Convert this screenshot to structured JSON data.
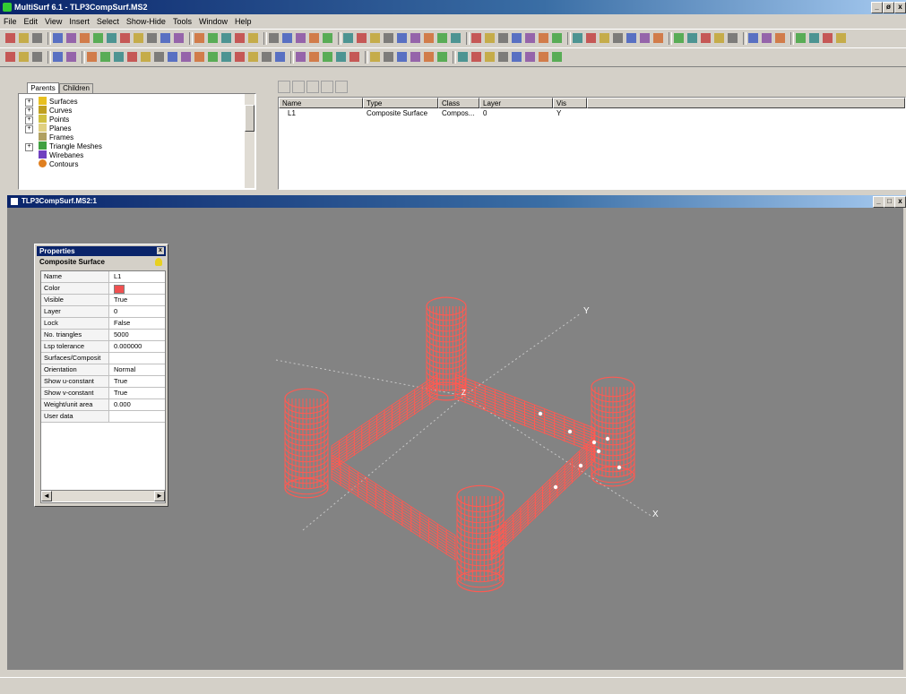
{
  "app": {
    "title": "MultiSurf 6.1 - TLP3CompSurf.MS2",
    "controls": [
      "_",
      "ø",
      "x"
    ]
  },
  "menu": [
    "File",
    "Edit",
    "View",
    "Insert",
    "Select",
    "Show-Hide",
    "Tools",
    "Window",
    "Help"
  ],
  "tree": {
    "tabs": [
      "Parents",
      "Children"
    ],
    "items": [
      "Surfaces",
      "Curves",
      "Points",
      "Planes",
      "Frames",
      "Triangle Meshes",
      "Wirebanes",
      "Contours"
    ]
  },
  "list": {
    "columns": [
      "Name",
      "Type",
      "Class",
      "Layer",
      "Vis"
    ],
    "rows": [
      {
        "name": "L1",
        "type": "Composite Surface",
        "class": "Compos...",
        "layer": "0",
        "vis": "Y"
      }
    ]
  },
  "child_window": {
    "title": "TLP3CompSurf.MS2:1",
    "controls": [
      "_",
      "□",
      "x"
    ]
  },
  "properties": {
    "title": "Properties",
    "entity": "Composite Surface",
    "rows": [
      {
        "key": "Name",
        "value": "L1"
      },
      {
        "key": "Color",
        "value": ""
      },
      {
        "key": "Visible",
        "value": "True"
      },
      {
        "key": "Layer",
        "value": "0"
      },
      {
        "key": "Lock",
        "value": "False"
      },
      {
        "key": "No. triangles",
        "value": "5000"
      },
      {
        "key": "Lsp tolerance",
        "value": "0.000000"
      },
      {
        "key": "Surfaces/Composit",
        "value": ""
      },
      {
        "key": "Orientation",
        "value": "Normal"
      },
      {
        "key": "Show u-constant",
        "value": "True"
      },
      {
        "key": "Show v-constant",
        "value": "True"
      },
      {
        "key": "Weight/unit area",
        "value": "0.000"
      },
      {
        "key": "User data",
        "value": ""
      }
    ],
    "color_swatch": "#f05050"
  },
  "axes": {
    "x": "X",
    "y": "Y",
    "z": "Z"
  },
  "colors": {
    "mesh": "#ff5a52",
    "viewport": "#838383",
    "titlebar": "#0a246a"
  }
}
